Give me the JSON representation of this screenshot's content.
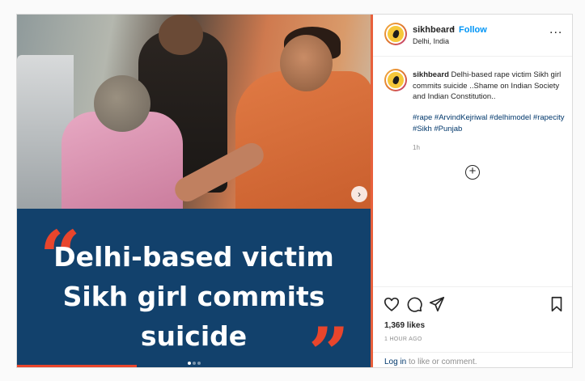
{
  "post": {
    "username": "sikhbeard",
    "separator": "•",
    "follow_label": "Follow",
    "location": "Delhi, India",
    "more_label": "...",
    "caption": {
      "username": "sikhbeard",
      "text": "Delhi-based rape victim Sikh girl commits suicide ..Shame on Indian Society and Indian Constitution..",
      "hashtags": "#rape #ArvindKejriwal #delhimodel #rapecity #Sikh #Punjab",
      "age": "1h"
    },
    "add_comment_icon": "plus-circle-icon",
    "likes": "1,369 likes",
    "timestamp": "1 HOUR AGO",
    "login_link": "Log in",
    "login_rest": " to like or comment."
  },
  "media": {
    "headline": "Delhi-based victim Sikh girl commits suicide",
    "open_quote": "“",
    "close_quote": "”",
    "next_label": "›",
    "carousel_total": 3,
    "carousel_active": 1
  },
  "icons": {
    "like": "heart-icon",
    "comment": "comment-icon",
    "share": "paper-plane-icon",
    "save": "bookmark-icon"
  },
  "colors": {
    "follow": "#0095f6",
    "hashtag": "#00376b",
    "banner": "#12416c",
    "accent": "#e8452c"
  }
}
